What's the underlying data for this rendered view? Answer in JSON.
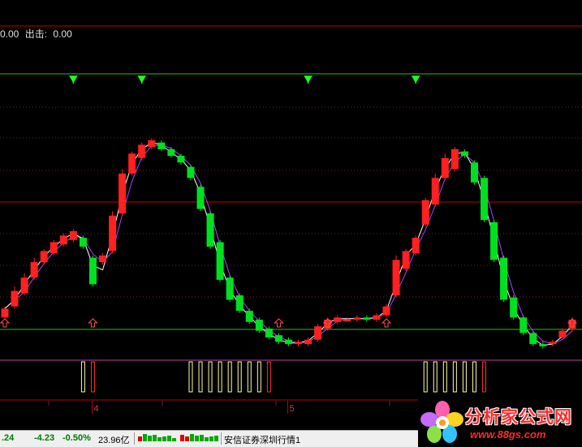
{
  "indicator": {
    "value_a": "0.00",
    "exit_label": "出击:",
    "exit_value": "0.00"
  },
  "axis": {
    "date_labels": [
      "4",
      "5"
    ]
  },
  "status_bar": {
    "price": ".24",
    "change": "-4.23",
    "change_pct": "-0.50%",
    "turnover": "23.96亿",
    "market_name": "安信证券深圳行情1"
  },
  "watermark": {
    "title": "分析家公式网",
    "url": "www.88gs.com"
  },
  "colors": {
    "up": "#ff2020",
    "down": "#00e020",
    "ma_line": "#ffffff",
    "ma_line2": "#b040ff",
    "level_red": "#c00000",
    "level_green": "#20c020",
    "signal_buy": "#ffffff",
    "signal_sell": "#ff3030"
  },
  "chart_data": {
    "type": "candlestick",
    "ylim": [
      0,
      1
    ],
    "levels": {
      "upper": 0.8,
      "mid": 0.5,
      "lower": 0.2
    },
    "candles": [
      {
        "o": 0.05,
        "c": 0.09,
        "h": 0.1,
        "l": 0.04
      },
      {
        "o": 0.1,
        "c": 0.17,
        "h": 0.19,
        "l": 0.09
      },
      {
        "o": 0.16,
        "c": 0.23,
        "h": 0.25,
        "l": 0.15
      },
      {
        "o": 0.23,
        "c": 0.3,
        "h": 0.32,
        "l": 0.22
      },
      {
        "o": 0.3,
        "c": 0.35,
        "h": 0.36,
        "l": 0.29
      },
      {
        "o": 0.34,
        "c": 0.39,
        "h": 0.4,
        "l": 0.33
      },
      {
        "o": 0.38,
        "c": 0.42,
        "h": 0.43,
        "l": 0.37
      },
      {
        "o": 0.4,
        "c": 0.44,
        "h": 0.45,
        "l": 0.39
      },
      {
        "o": 0.41,
        "c": 0.37,
        "h": 0.42,
        "l": 0.36
      },
      {
        "o": 0.32,
        "c": 0.2,
        "h": 0.33,
        "l": 0.19
      },
      {
        "o": 0.3,
        "c": 0.33,
        "h": 0.34,
        "l": 0.29
      },
      {
        "o": 0.35,
        "c": 0.51,
        "h": 0.53,
        "l": 0.34
      },
      {
        "o": 0.52,
        "c": 0.7,
        "h": 0.72,
        "l": 0.51
      },
      {
        "o": 0.7,
        "c": 0.79,
        "h": 0.8,
        "l": 0.69
      },
      {
        "o": 0.77,
        "c": 0.83,
        "h": 0.84,
        "l": 0.76
      },
      {
        "o": 0.82,
        "c": 0.85,
        "h": 0.86,
        "l": 0.81
      },
      {
        "o": 0.84,
        "c": 0.81,
        "h": 0.85,
        "l": 0.8
      },
      {
        "o": 0.81,
        "c": 0.78,
        "h": 0.82,
        "l": 0.77
      },
      {
        "o": 0.78,
        "c": 0.75,
        "h": 0.79,
        "l": 0.74
      },
      {
        "o": 0.73,
        "c": 0.68,
        "h": 0.74,
        "l": 0.67
      },
      {
        "o": 0.64,
        "c": 0.54,
        "h": 0.65,
        "l": 0.53
      },
      {
        "o": 0.52,
        "c": 0.37,
        "h": 0.53,
        "l": 0.36
      },
      {
        "o": 0.39,
        "c": 0.22,
        "h": 0.4,
        "l": 0.21
      },
      {
        "o": 0.23,
        "c": 0.13,
        "h": 0.24,
        "l": 0.12
      },
      {
        "o": 0.15,
        "c": 0.08,
        "h": 0.16,
        "l": 0.07
      },
      {
        "o": 0.08,
        "c": 0.03,
        "h": 0.09,
        "l": 0.02
      },
      {
        "o": 0.04,
        "c": -0.01,
        "h": 0.05,
        "l": -0.02
      },
      {
        "o": 0.0,
        "c": -0.04,
        "h": 0.01,
        "l": -0.05
      },
      {
        "o": -0.03,
        "c": -0.06,
        "h": -0.02,
        "l": -0.07
      },
      {
        "o": -0.05,
        "c": -0.07,
        "h": -0.04,
        "l": -0.08
      },
      {
        "o": -0.07,
        "c": -0.06,
        "h": -0.05,
        "l": -0.08
      },
      {
        "o": -0.07,
        "c": -0.05,
        "h": -0.04,
        "l": -0.08
      },
      {
        "o": -0.05,
        "c": 0.01,
        "h": 0.02,
        "l": -0.06
      },
      {
        "o": 0.0,
        "c": 0.04,
        "h": 0.05,
        "l": -0.01
      },
      {
        "o": 0.03,
        "c": 0.05,
        "h": 0.06,
        "l": 0.02
      },
      {
        "o": 0.04,
        "c": 0.04,
        "h": 0.05,
        "l": 0.03
      },
      {
        "o": 0.04,
        "c": 0.05,
        "h": 0.06,
        "l": 0.03
      },
      {
        "o": 0.05,
        "c": 0.04,
        "h": 0.06,
        "l": 0.03
      },
      {
        "o": 0.04,
        "c": 0.06,
        "h": 0.07,
        "l": 0.03
      },
      {
        "o": 0.06,
        "c": 0.1,
        "h": 0.11,
        "l": 0.05
      },
      {
        "o": 0.15,
        "c": 0.31,
        "h": 0.33,
        "l": 0.14
      },
      {
        "o": 0.27,
        "c": 0.35,
        "h": 0.36,
        "l": 0.26
      },
      {
        "o": 0.34,
        "c": 0.41,
        "h": 0.42,
        "l": 0.33
      },
      {
        "o": 0.47,
        "c": 0.58,
        "h": 0.59,
        "l": 0.46
      },
      {
        "o": 0.56,
        "c": 0.68,
        "h": 0.7,
        "l": 0.55
      },
      {
        "o": 0.68,
        "c": 0.77,
        "h": 0.79,
        "l": 0.67
      },
      {
        "o": 0.72,
        "c": 0.81,
        "h": 0.82,
        "l": 0.71
      },
      {
        "o": 0.8,
        "c": 0.78,
        "h": 0.81,
        "l": 0.77
      },
      {
        "o": 0.75,
        "c": 0.66,
        "h": 0.76,
        "l": 0.65
      },
      {
        "o": 0.68,
        "c": 0.49,
        "h": 0.69,
        "l": 0.48
      },
      {
        "o": 0.48,
        "c": 0.31,
        "h": 0.49,
        "l": 0.3
      },
      {
        "o": 0.32,
        "c": 0.13,
        "h": 0.33,
        "l": 0.12
      },
      {
        "o": 0.14,
        "c": 0.05,
        "h": 0.15,
        "l": 0.04
      },
      {
        "o": 0.05,
        "c": -0.02,
        "h": 0.06,
        "l": -0.03
      },
      {
        "o": -0.02,
        "c": -0.07,
        "h": -0.01,
        "l": -0.08
      },
      {
        "o": -0.07,
        "c": -0.08,
        "h": -0.06,
        "l": -0.09
      },
      {
        "o": -0.07,
        "c": -0.06,
        "h": -0.05,
        "l": -0.08
      },
      {
        "o": -0.04,
        "c": -0.01,
        "h": 0.0,
        "l": -0.05
      },
      {
        "o": 0.0,
        "c": 0.04,
        "h": 0.05,
        "l": -0.01
      }
    ],
    "sell_signals": [
      7,
      14,
      31,
      42
    ],
    "buy_signals": [
      0,
      9,
      28,
      33,
      39,
      58
    ],
    "signal_bars": [
      {
        "i": 8,
        "kind": "buy"
      },
      {
        "i": 9,
        "kind": "sell"
      },
      {
        "i": 19,
        "kind": "buy"
      },
      {
        "i": 20,
        "kind": "buy"
      },
      {
        "i": 21,
        "kind": "buy"
      },
      {
        "i": 22,
        "kind": "buy"
      },
      {
        "i": 23,
        "kind": "buy"
      },
      {
        "i": 24,
        "kind": "buy"
      },
      {
        "i": 25,
        "kind": "buy"
      },
      {
        "i": 26,
        "kind": "buy"
      },
      {
        "i": 27,
        "kind": "sell"
      },
      {
        "i": 43,
        "kind": "buy"
      },
      {
        "i": 44,
        "kind": "buy"
      },
      {
        "i": 45,
        "kind": "buy"
      },
      {
        "i": 46,
        "kind": "buy"
      },
      {
        "i": 47,
        "kind": "buy"
      },
      {
        "i": 48,
        "kind": "buy"
      },
      {
        "i": 49,
        "kind": "sell"
      }
    ]
  }
}
